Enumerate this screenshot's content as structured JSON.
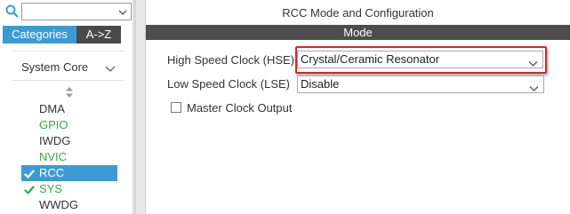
{
  "search": {
    "value": ""
  },
  "tabs": {
    "categories": "Categories",
    "az": "A->Z"
  },
  "category": {
    "label": "System Core"
  },
  "items": [
    {
      "label": "DMA",
      "color": "dark",
      "checked": false,
      "selected": false
    },
    {
      "label": "GPIO",
      "color": "green",
      "checked": false,
      "selected": false
    },
    {
      "label": "IWDG",
      "color": "dark",
      "checked": false,
      "selected": false
    },
    {
      "label": "NVIC",
      "color": "green",
      "checked": false,
      "selected": false
    },
    {
      "label": "RCC",
      "color": "light",
      "checked": true,
      "selected": true
    },
    {
      "label": "SYS",
      "color": "green",
      "checked": true,
      "selected": false
    },
    {
      "label": "WWDG",
      "color": "dark",
      "checked": false,
      "selected": false
    }
  ],
  "panel": {
    "title": "RCC Mode and Configuration",
    "mode_header": "Mode",
    "hse_label": "High Speed Clock (HSE)",
    "hse_value": "Crystal/Ceramic Resonator",
    "lse_label": "Low Speed Clock (LSE)",
    "lse_value": "Disable",
    "mco_label": "Master Clock Output",
    "mco_checked": false
  },
  "colors": {
    "accent_blue": "#3c9bd4",
    "tab_dark": "#4a4a4a",
    "status_green": "#3aa84a",
    "highlight_red": "#d4272b",
    "mode_bar": "#4d4d4d"
  }
}
